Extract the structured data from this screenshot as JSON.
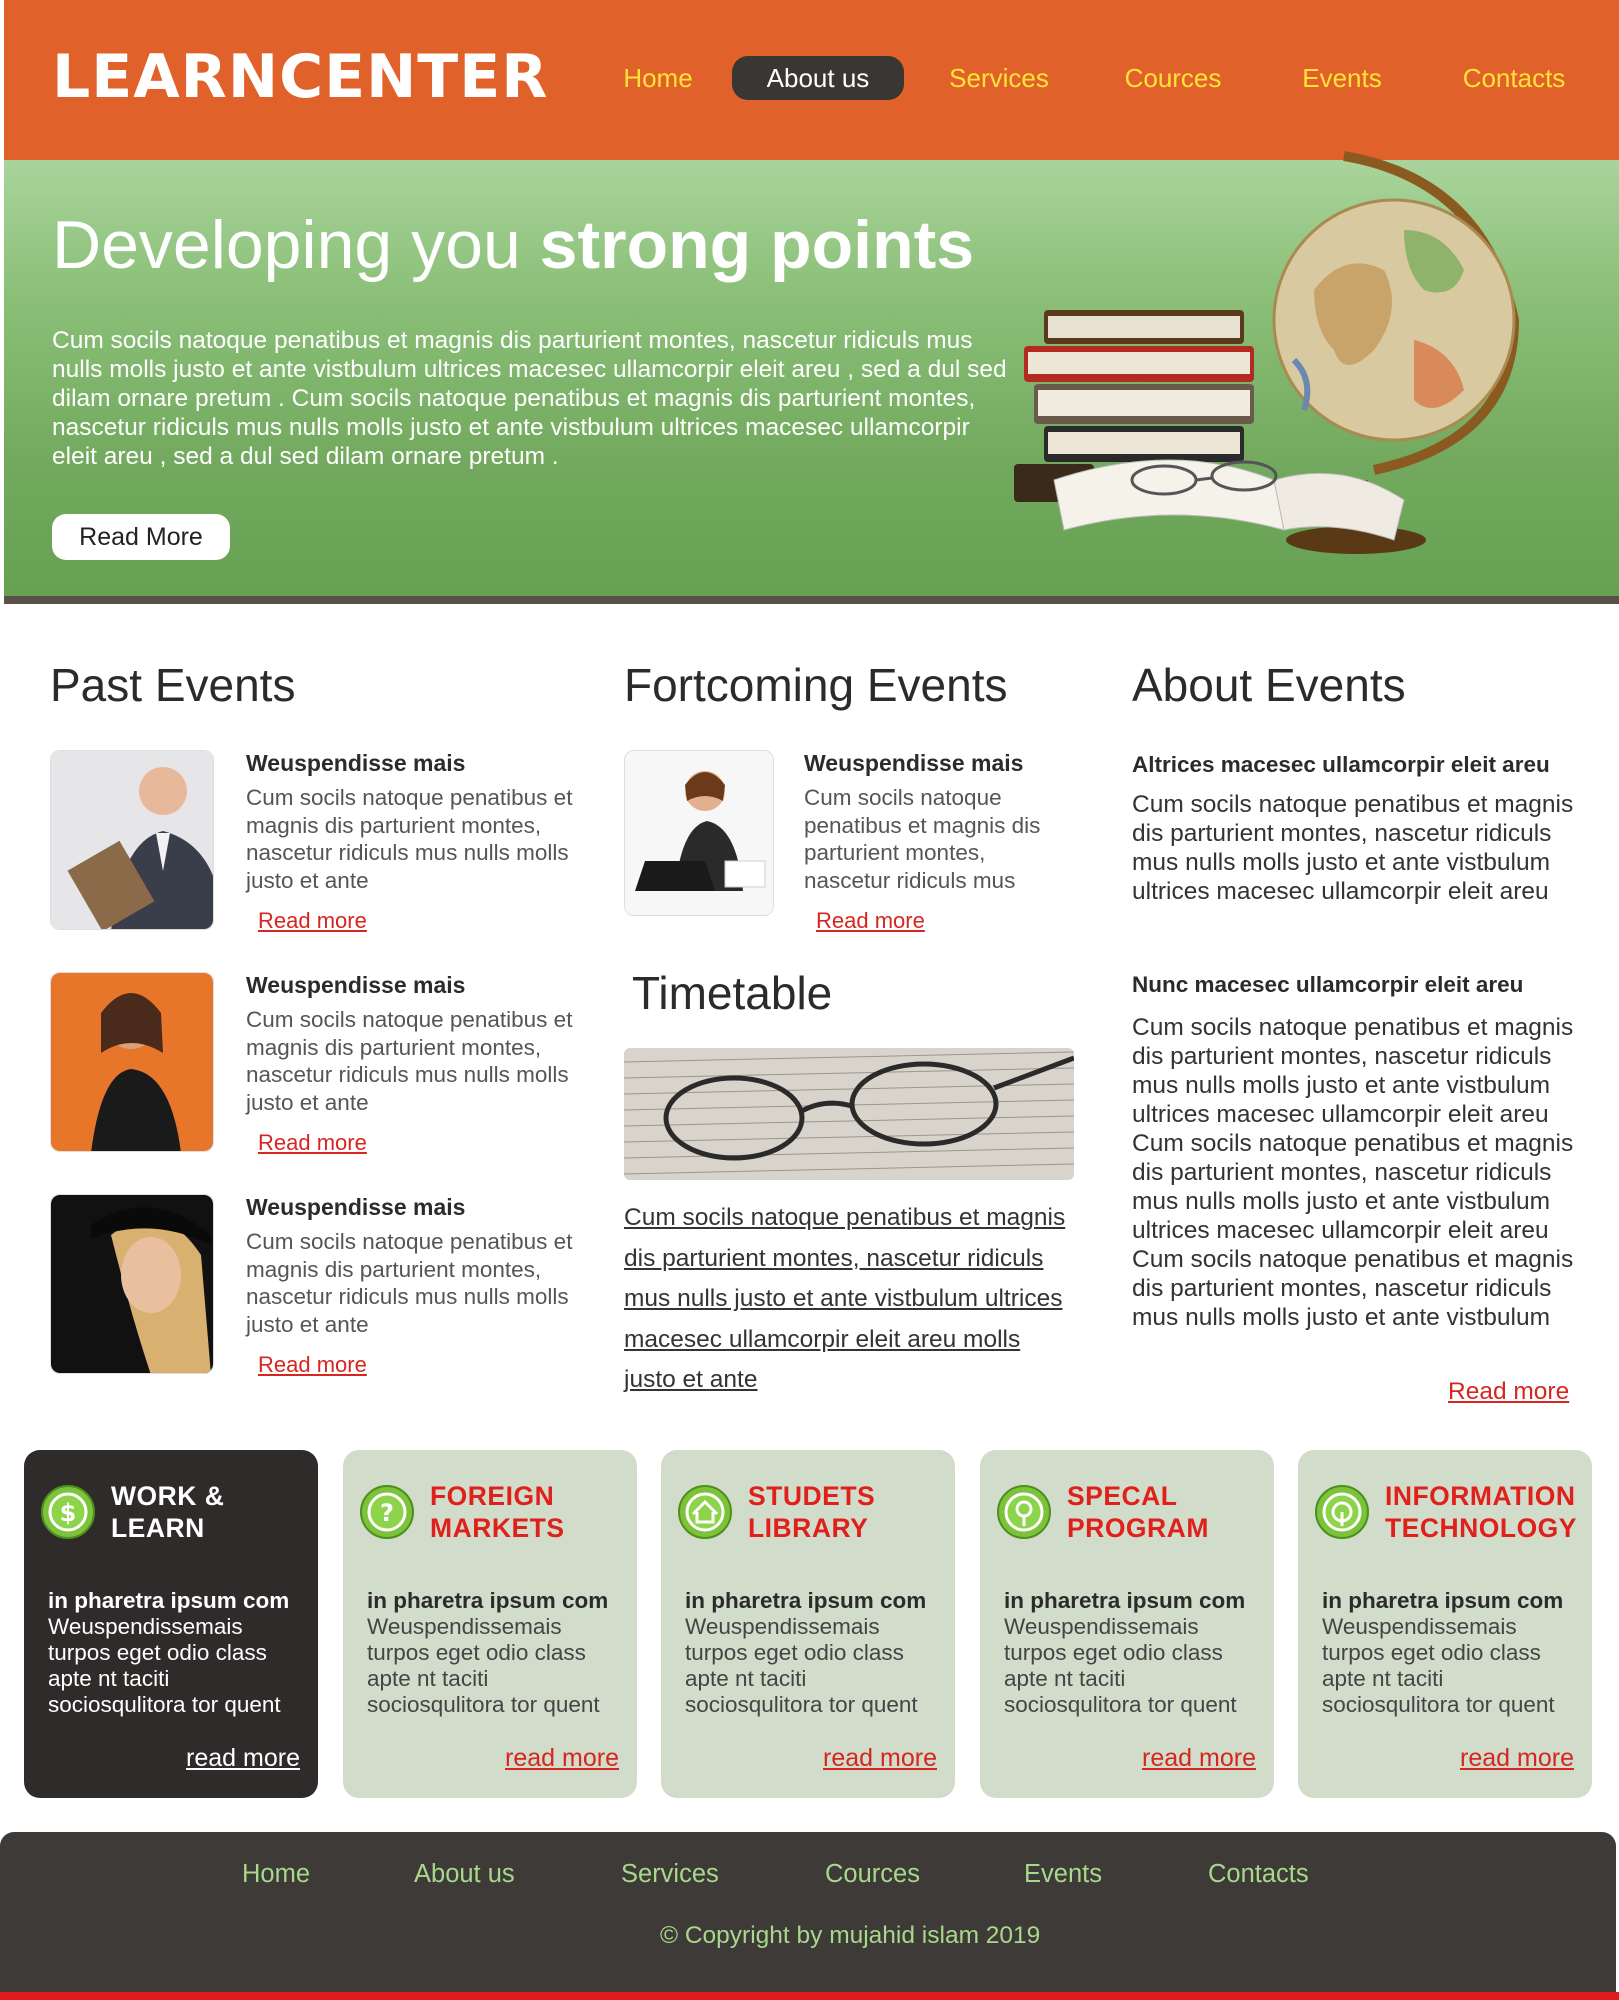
{
  "header": {
    "logo": "LEARNCENTER",
    "nav": [
      "Home",
      "About us",
      "Services",
      "Cources",
      "Events",
      "Contacts"
    ],
    "active_nav": "About us",
    "colors": {
      "header_bg": "#e0622a",
      "nav_text": "#ffe23a",
      "active_bg": "#3a3634"
    }
  },
  "hero": {
    "title_light": "Developing you",
    "title_bold": "strong points",
    "text": "Cum socils natoque penatibus et magnis dis parturient montes, nascetur ridiculs mus nulls molls justo et ante vistbulum ultrices macesec ullamcorpir eleit areu , sed a dul sed dilam ornare pretum . Cum socils natoque penatibus et magnis dis parturient montes, nascetur ridiculs mus nulls molls justo et ante vistbulum ultrices macesec ullamcorpir eleit areu , sed a dul sed dilam ornare pretum .",
    "button": "Read More",
    "image_icon": "globe-and-books-icon"
  },
  "past_events": {
    "title": "Past Events",
    "items": [
      {
        "title": "Weuspendisse mais",
        "text": "Cum socils natoque penatibus et magnis dis parturient montes, nascetur ridiculs mus nulls molls justo et ante",
        "link": "Read more"
      },
      {
        "title": "Weuspendisse mais",
        "text": "Cum socils natoque penatibus et magnis dis parturient montes, nascetur ridiculs mus nulls molls justo et ante",
        "link": "Read more"
      },
      {
        "title": "Weuspendisse mais",
        "text": "Cum socils natoque penatibus et magnis dis parturient montes, nascetur ridiculs mus nulls molls justo et ante",
        "link": "Read more"
      }
    ]
  },
  "forthcoming": {
    "title": "Fortcoming Events",
    "item": {
      "title": "Weuspendisse mais",
      "text": "Cum socils natoque penatibus et magnis dis parturient montes, nascetur ridiculs mus",
      "link": "Read more"
    }
  },
  "timetable": {
    "title": "Timetable",
    "text": "Cum socils natoque penatibus et magnis dis parturient montes, nascetur ridiculs mus nulls justo et ante vistbulum ultrices macesec ullamcorpir eleit areu molls justo et ante"
  },
  "about_events": {
    "title": "About Events",
    "sub1": "Altrices macesec ullamcorpir eleit areu",
    "text1": "Cum socils natoque penatibus et magnis dis parturient montes, nascetur ridiculs mus nulls molls justo et ante vistbulum ultrices macesec ullamcorpir eleit areu",
    "sub2": "Nunc macesec ullamcorpir eleit areu",
    "text2": "Cum socils natoque penatibus et magnis dis parturient montes, nascetur ridiculs mus nulls molls justo et ante vistbulum ultrices macesec ullamcorpir eleit areu Cum socils natoque penatibus et magnis dis parturient montes, nascetur ridiculs mus nulls molls justo et ante vistbulum ultrices macesec ullamcorpir eleit areu Cum socils natoque penatibus et magnis dis parturient montes, nascetur ridiculs mus nulls molls justo et ante vistbulum",
    "link": "Read more"
  },
  "boxes": [
    {
      "title": "WORK & LEARN",
      "icon": "dollar-icon",
      "sub": "in pharetra ipsum com",
      "text": "Weuspendissemais turpos eget odio class apte nt taciti sociosqulitora tor quent",
      "link": "read more"
    },
    {
      "title": "FOREIGN MARKETS",
      "icon": "question-icon",
      "sub": "in pharetra ipsum com",
      "text": "Weuspendissemais turpos eget odio class apte nt taciti sociosqulitora tor quent",
      "link": "read more"
    },
    {
      "title": "STUDETS LIBRARY",
      "icon": "home-icon",
      "sub": "in pharetra ipsum com",
      "text": "Weuspendissemais turpos eget odio class apte nt taciti sociosqulitora tor quent",
      "link": "read more"
    },
    {
      "title": "SPECAL PROGRAM",
      "icon": "search-icon",
      "sub": "in pharetra ipsum com",
      "text": "Weuspendissemais turpos eget odio class apte nt taciti sociosqulitora tor quent",
      "link": "read more"
    },
    {
      "title": "INFORMATION TECHNOLOGY",
      "icon": "target-icon",
      "sub": "in pharetra ipsum com",
      "text": "Weuspendissemais turpos eget odio class apte nt taciti sociosqulitora tor quent",
      "link": "read more"
    }
  ],
  "footer": {
    "nav": [
      "Home",
      "About us",
      "Services",
      "Cources",
      "Events",
      "Contacts"
    ],
    "copyright": "© Copyright by mujahid islam 2019"
  }
}
